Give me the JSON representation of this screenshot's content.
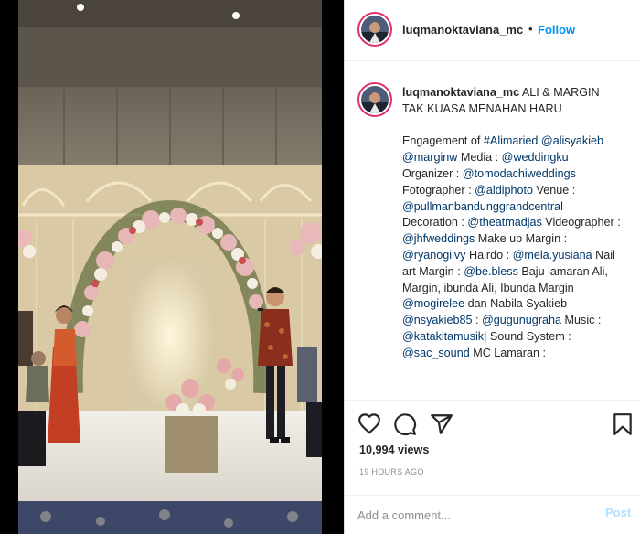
{
  "post": {
    "username": "luqmanoktaviana_mc",
    "follow_label": "Follow",
    "separator": "•"
  },
  "caption": {
    "username": "luqmanoktaviana_mc",
    "headline": "ALI & MARGIN TAK KUASA MENAHAN HARU",
    "body": [
      {
        "text": "Engagement of "
      },
      {
        "text": "#Alimaried",
        "tag": true
      },
      {
        "text": " "
      },
      {
        "text": "@alisyakieb",
        "tag": true
      },
      {
        "text": " "
      },
      {
        "text": "@marginw",
        "tag": true
      },
      {
        "text": " Media : "
      },
      {
        "text": "@weddingku",
        "tag": true
      },
      {
        "text": " Organizer : "
      },
      {
        "text": "@tomodachiweddings",
        "tag": true
      },
      {
        "text": " Fotographer : "
      },
      {
        "text": "@aldiphoto",
        "tag": true
      },
      {
        "text": " Venue : "
      },
      {
        "text": "@pullmanbandunggrandcentral",
        "tag": true
      },
      {
        "text": " Decoration : "
      },
      {
        "text": "@theatmadjas",
        "tag": true
      },
      {
        "text": " Videographer : "
      },
      {
        "text": "@jhfweddings",
        "tag": true
      },
      {
        "text": " Make up Margin : "
      },
      {
        "text": "@ryanogilvy",
        "tag": true
      },
      {
        "text": " Hairdo : "
      },
      {
        "text": "@mela.yusiana",
        "tag": true
      },
      {
        "text": " Nail art Margin : "
      },
      {
        "text": "@be.bless",
        "tag": true
      },
      {
        "text": " Baju lamaran Ali, Margin, ibunda Ali, Ibunda Margin "
      },
      {
        "text": "@mogirelee",
        "tag": true
      },
      {
        "text": " dan Nabila Syakieb "
      },
      {
        "text": "@nsyakieb85",
        "tag": true
      },
      {
        "text": " : "
      },
      {
        "text": "@gugunugraha",
        "tag": true
      },
      {
        "text": " Music : "
      },
      {
        "text": "@katakitamusik",
        "tag": true
      },
      {
        "text": "| Sound System : "
      },
      {
        "text": "@sac_sound",
        "tag": true
      },
      {
        "text": " MC Lamaran :"
      }
    ]
  },
  "stats": {
    "views": "10,994 views",
    "timestamp": "19 HOURS AGO"
  },
  "comment": {
    "placeholder": "Add a comment...",
    "post_label": "Post"
  },
  "colors": {
    "link": "#00376b",
    "follow": "#0095f6",
    "post_disabled": "#b2dffc",
    "avatar_ring": "#e1306c"
  },
  "icons": [
    "heart-icon",
    "comment-icon",
    "share-icon",
    "bookmark-icon"
  ]
}
